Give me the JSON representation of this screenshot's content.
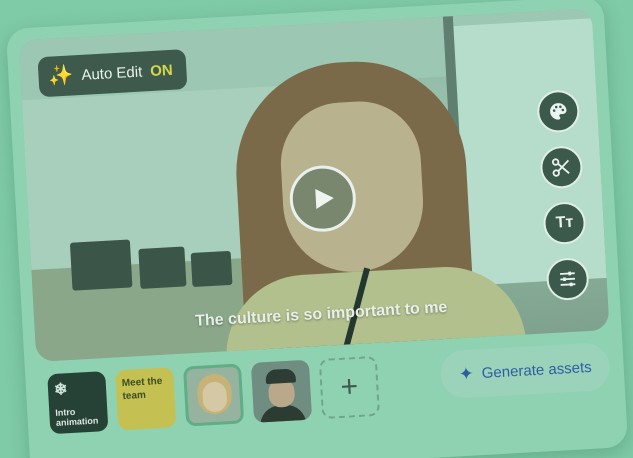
{
  "auto_edit": {
    "label": "Auto Edit",
    "state": "ON"
  },
  "video": {
    "caption": "The culture is so important to me"
  },
  "tools": {
    "text_tool_label": "Tт"
  },
  "strip": {
    "intro_label": "Intro animation",
    "meet_label": "Meet the team",
    "add_label": "+"
  },
  "generate": {
    "label": "Generate assets"
  },
  "colors": {
    "overlay_green": "#7fcaa7",
    "dark_pill": "#3e5a4c",
    "on_yellow": "#d4d84a",
    "generate_blue": "#2f5ea0"
  }
}
